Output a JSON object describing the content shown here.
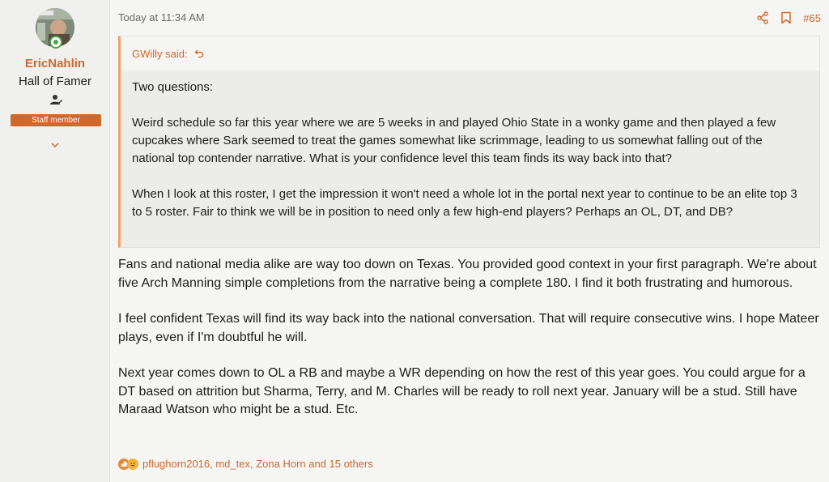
{
  "user": {
    "name": "EricNahlin",
    "title": "Hall of Famer",
    "badge": "Staff member"
  },
  "post": {
    "timestamp": "Today at 11:34 AM",
    "number": "#65"
  },
  "quote": {
    "author": "GWilly said:",
    "paragraphs": [
      "Two questions:",
      "Weird schedule so far this year where we are 5 weeks in and played Ohio State in a wonky game and then played a few cupcakes where Sark seemed to treat the games somewhat like scrimmage, leading to us somewhat falling out of the national top contender narrative. What is your confidence level this team finds its way back into that?",
      "When I look at this roster, I get the impression it won't need a whole lot in the portal next year to continue to be an elite top 3 to 5 roster. Fair to think we will be in position to need only a few high-end players? Perhaps an OL, DT, and DB?"
    ]
  },
  "message": {
    "paragraphs": [
      "Fans and national media alike are way too down on Texas. You provided good context in your first paragraph. We're about five Arch Manning simple completions from the narrative being a complete 180. I find it both frustrating and humorous.",
      "I feel confident Texas will find its way back into the national conversation. That will require consecutive wins. I hope Mateer plays, even if I'm doubtful he will.",
      "Next year comes down to OL a RB and maybe a WR depending on how the rest of this year goes. You could argue for a DT based on attrition but Sharma, Terry, and M. Charles will be ready to roll next year. January will be a stud. Still have Maraad Watson who might be a stud. Etc."
    ]
  },
  "reactions": {
    "text": "pflughorn2016, md_tex, Zona Horn and 15 others",
    "icons": [
      "like-icon",
      "laugh-icon"
    ]
  },
  "colors": {
    "accent": "#d0682c",
    "online": "#4aa64a"
  }
}
